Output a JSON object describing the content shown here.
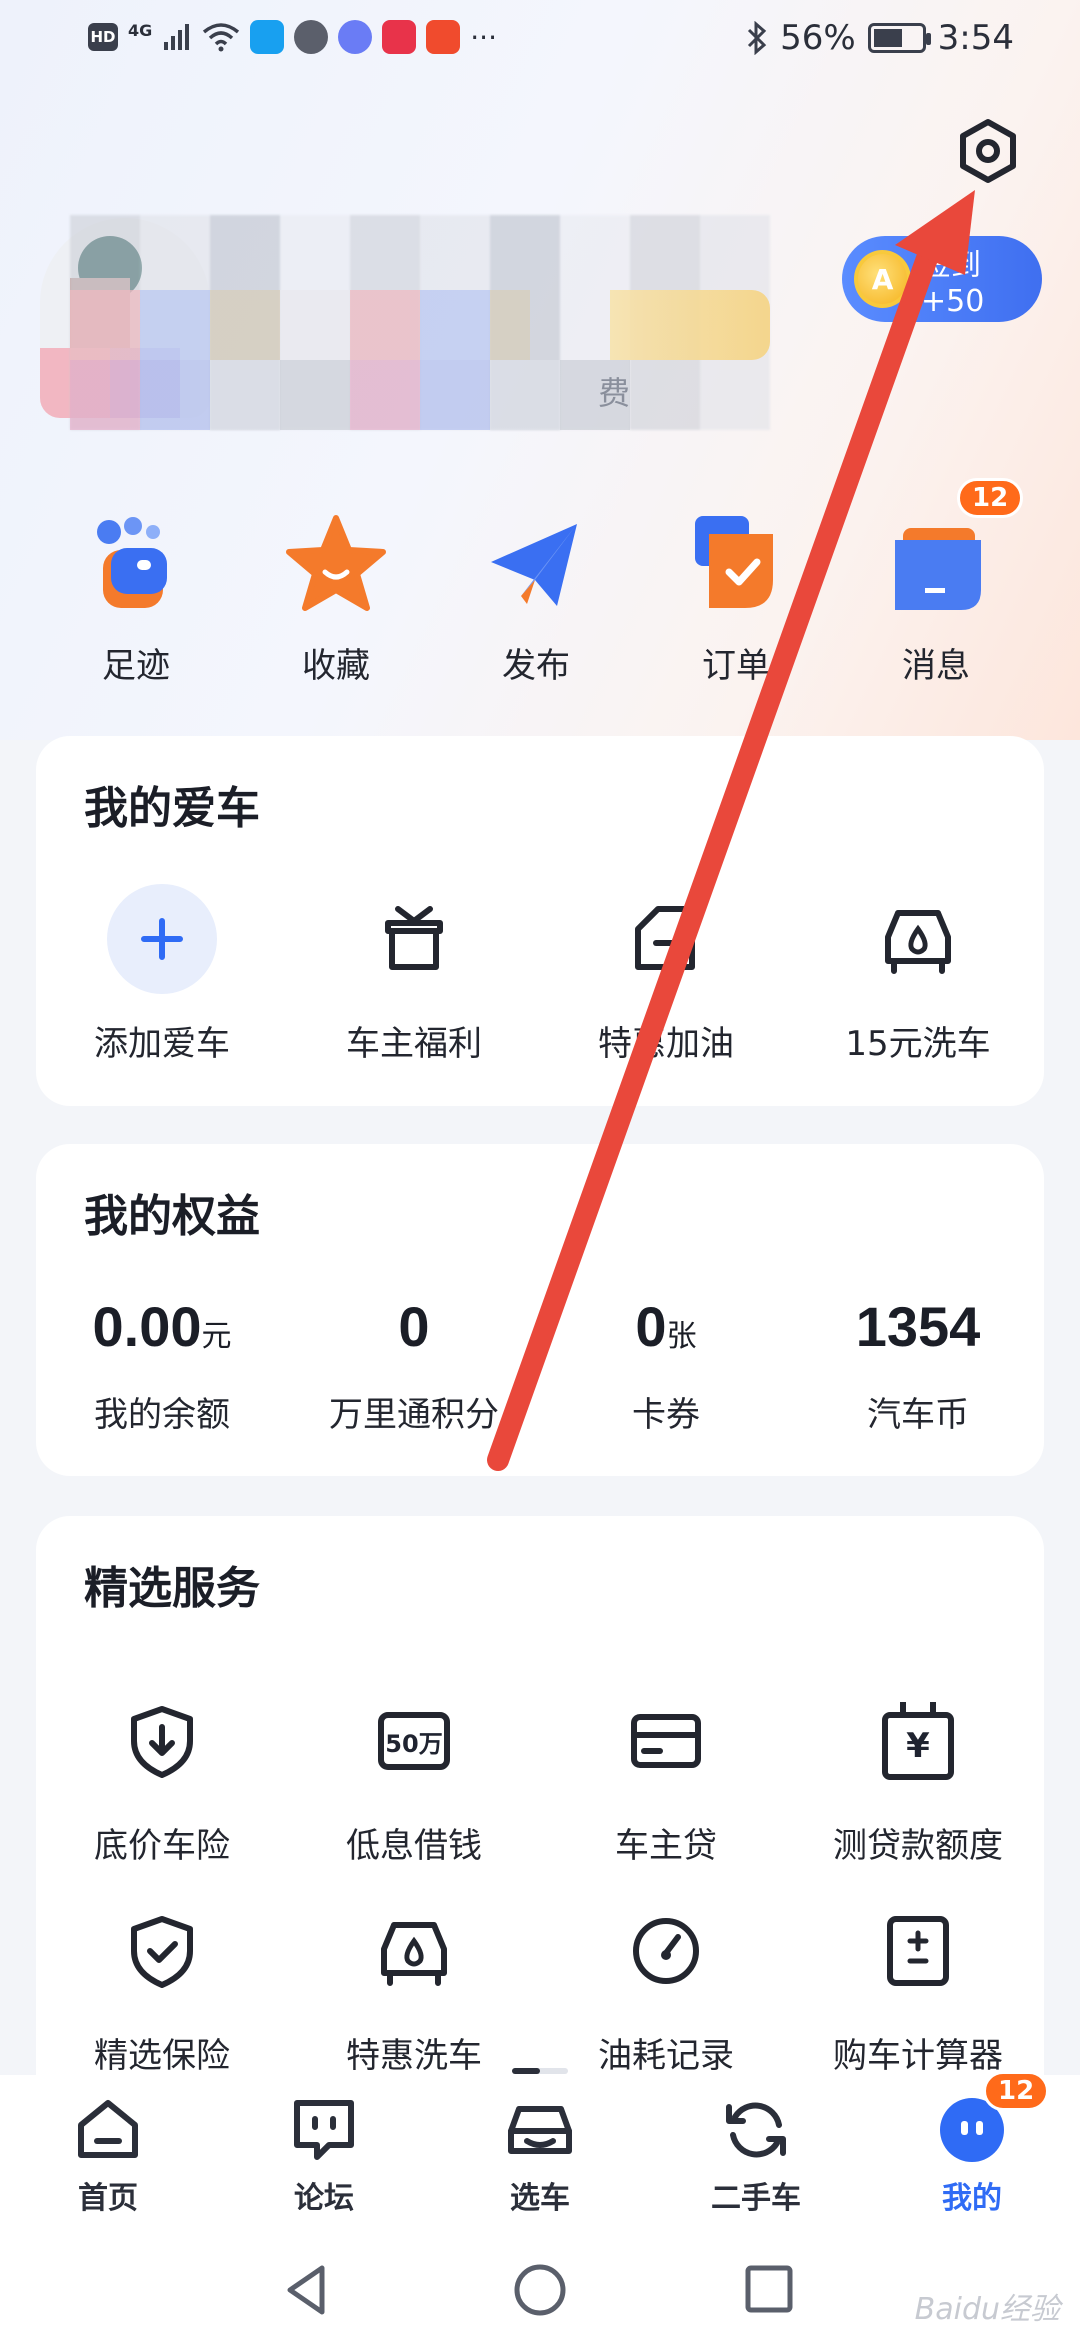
{
  "status_bar": {
    "network_badge": "HD",
    "net_type": "4G",
    "battery_percent": "56%",
    "time": "3:54",
    "more": "···"
  },
  "header": {
    "checkin_label": "签到+50",
    "coin_letter": "A",
    "masked_tail": "费"
  },
  "quick_actions": [
    {
      "label": "足迹",
      "icon": "footprint-icon"
    },
    {
      "label": "收藏",
      "icon": "star-icon"
    },
    {
      "label": "发布",
      "icon": "paper-plane-icon"
    },
    {
      "label": "订单",
      "icon": "order-icon"
    },
    {
      "label": "消息",
      "icon": "message-icon",
      "badge": "12"
    }
  ],
  "my_car": {
    "title": "我的爱车",
    "items": [
      {
        "label": "添加爱车",
        "icon": "plus-icon"
      },
      {
        "label": "车主福利",
        "icon": "gift-icon"
      },
      {
        "label": "特惠加油",
        "icon": "fuel-icon"
      },
      {
        "label": "15元洗车",
        "icon": "car-wash-icon"
      }
    ]
  },
  "my_benefits": {
    "title": "我的权益",
    "stats": [
      {
        "value": "0.00",
        "unit": "元",
        "label": "我的余额"
      },
      {
        "value": "0",
        "unit": "",
        "label": "万里通积分"
      },
      {
        "value": "0",
        "unit": "张",
        "label": "卡券"
      },
      {
        "value": "1354",
        "unit": "",
        "label": "汽车币"
      }
    ]
  },
  "services": {
    "title": "精选服务",
    "row1": [
      {
        "label": "底价车险",
        "icon": "shield-download-icon"
      },
      {
        "label": "低息借钱",
        "icon": "50-wan-icon",
        "icon_text": "50万"
      },
      {
        "label": "车主贷",
        "icon": "card-icon"
      },
      {
        "label": "测贷款额度",
        "icon": "calendar-yen-icon",
        "icon_text": "¥"
      }
    ],
    "row2": [
      {
        "label": "精选保险",
        "icon": "shield-check-icon"
      },
      {
        "label": "特惠洗车",
        "icon": "car-wash-icon"
      },
      {
        "label": "油耗记录",
        "icon": "gauge-icon"
      },
      {
        "label": "购车计算器",
        "icon": "calculator-icon"
      }
    ]
  },
  "bottom_nav": [
    {
      "label": "首页",
      "icon": "home-icon"
    },
    {
      "label": "论坛",
      "icon": "forum-icon"
    },
    {
      "label": "选车",
      "icon": "car-select-icon"
    },
    {
      "label": "二手车",
      "icon": "refresh-icon"
    },
    {
      "label": "我的",
      "icon": "profile-icon",
      "badge": "12",
      "active": true
    }
  ],
  "watermark": "Baidu经验",
  "colors": {
    "accent": "#2f6bf5",
    "badge": "#ff6a1a",
    "annotation_arrow": "#e9483b"
  }
}
